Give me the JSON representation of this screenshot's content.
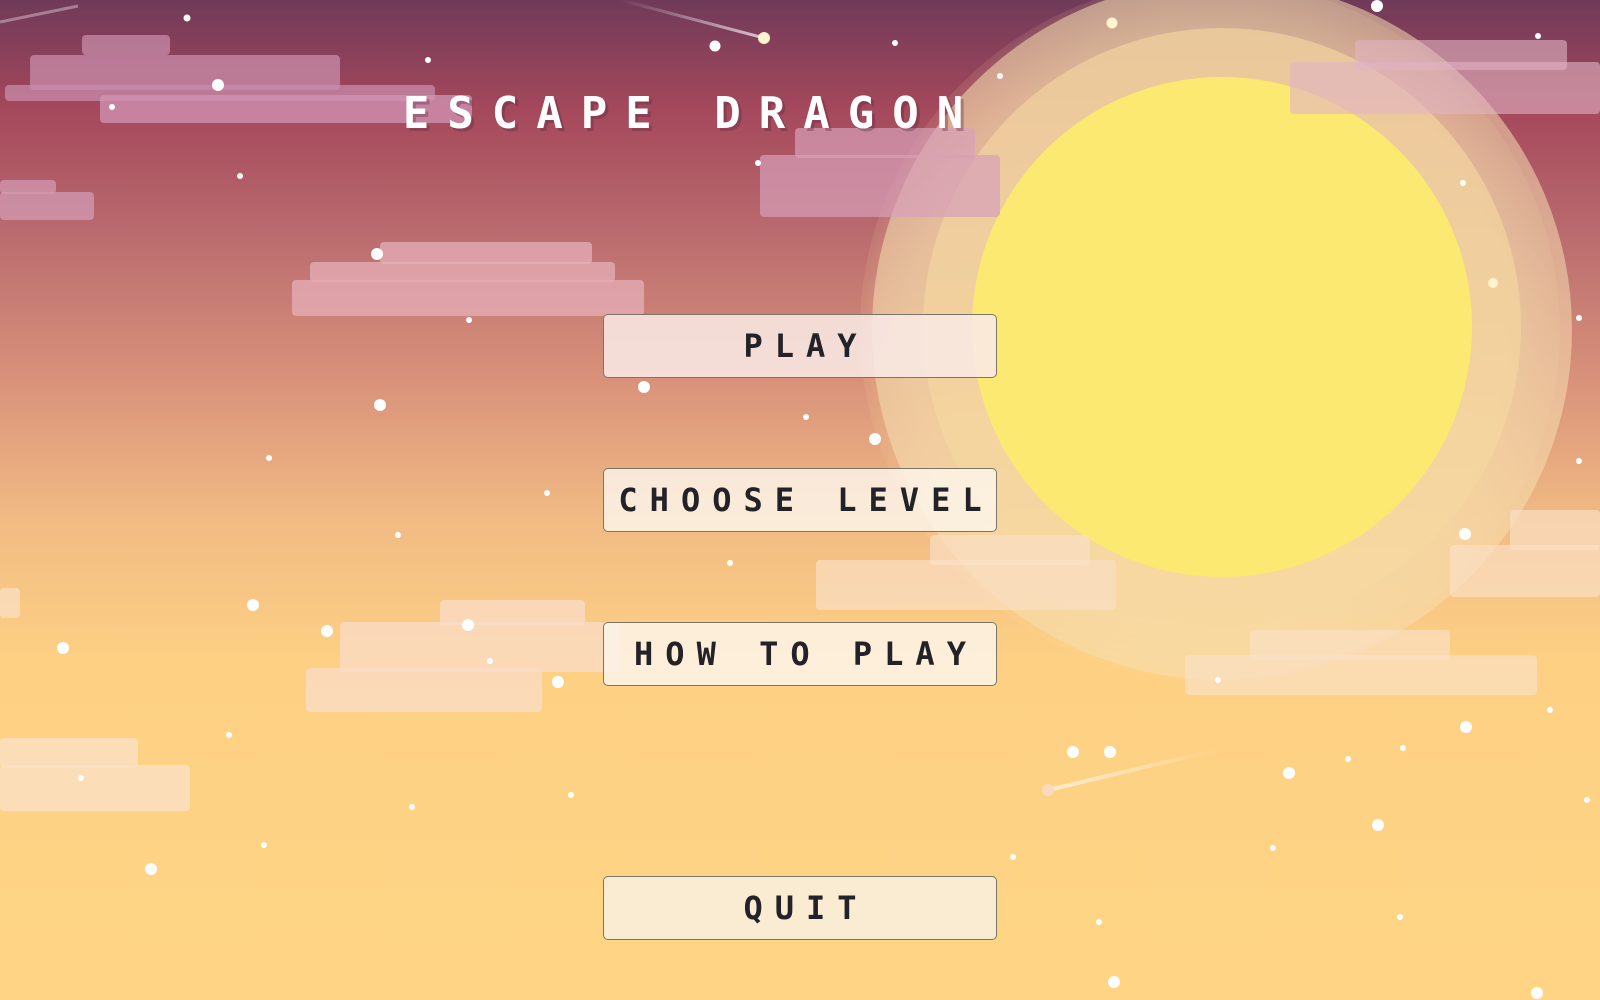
{
  "game": {
    "title": "ESCAPE DRAGON"
  },
  "menu": {
    "play_label": "PLAY",
    "choose_level_label": "CHOOSE LEVEL",
    "how_to_play_label": "HOW TO PLAY",
    "quit_label": "QUIT"
  },
  "scene": {
    "sun_color": "#fce972",
    "sky_top_color": "#703a59",
    "sky_bottom_color": "#ffd585",
    "button_text_color": "#232228"
  }
}
